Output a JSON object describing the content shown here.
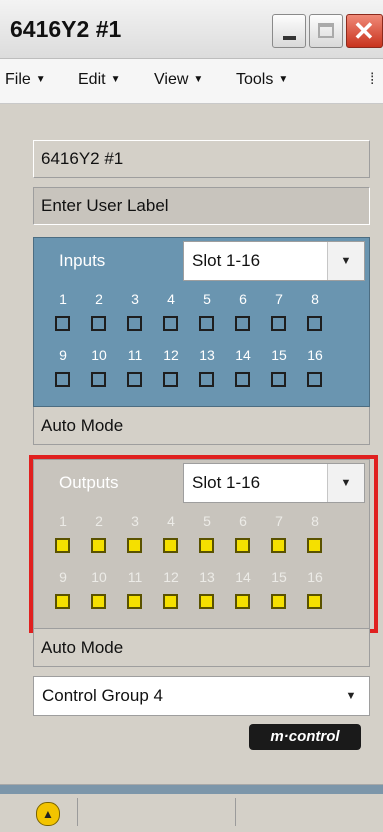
{
  "window": {
    "title": "6416Y2 #1"
  },
  "menu": [
    {
      "label": "File"
    },
    {
      "label": "Edit"
    },
    {
      "label": "View"
    },
    {
      "label": "Tools"
    }
  ],
  "device_name": "6416Y2 #1",
  "user_label_field": {
    "value": "Enter User Label"
  },
  "inputs": {
    "label": "Inputs",
    "slot": "Slot 1-16",
    "numbers_row1": [
      "1",
      "2",
      "3",
      "4",
      "5",
      "6",
      "7",
      "8"
    ],
    "numbers_row2": [
      "9",
      "10",
      "11",
      "12",
      "13",
      "14",
      "15",
      "16"
    ],
    "states": [
      false,
      false,
      false,
      false,
      false,
      false,
      false,
      false,
      false,
      false,
      false,
      false,
      false,
      false,
      false,
      false
    ],
    "mode": "Auto Mode"
  },
  "outputs": {
    "label": "Outputs",
    "slot": "Slot 1-16",
    "numbers_row1": [
      "1",
      "2",
      "3",
      "4",
      "5",
      "6",
      "7",
      "8"
    ],
    "numbers_row2": [
      "9",
      "10",
      "11",
      "12",
      "13",
      "14",
      "15",
      "16"
    ],
    "states": [
      true,
      true,
      true,
      true,
      true,
      true,
      true,
      true,
      true,
      true,
      true,
      true,
      true,
      true,
      true,
      true
    ],
    "mode": "Auto Mode"
  },
  "control_group": {
    "value": "Control Group 4"
  },
  "logo_text": "m·control",
  "colors": {
    "input_panel": "#6a95b0",
    "output_led_on": "#f5e000",
    "highlight": "#e0201f",
    "close_button": "#c8331e"
  },
  "icons": {
    "minimize": "minimize-icon",
    "maximize": "maximize-icon",
    "close": "close-icon",
    "status": "status-up-icon"
  }
}
